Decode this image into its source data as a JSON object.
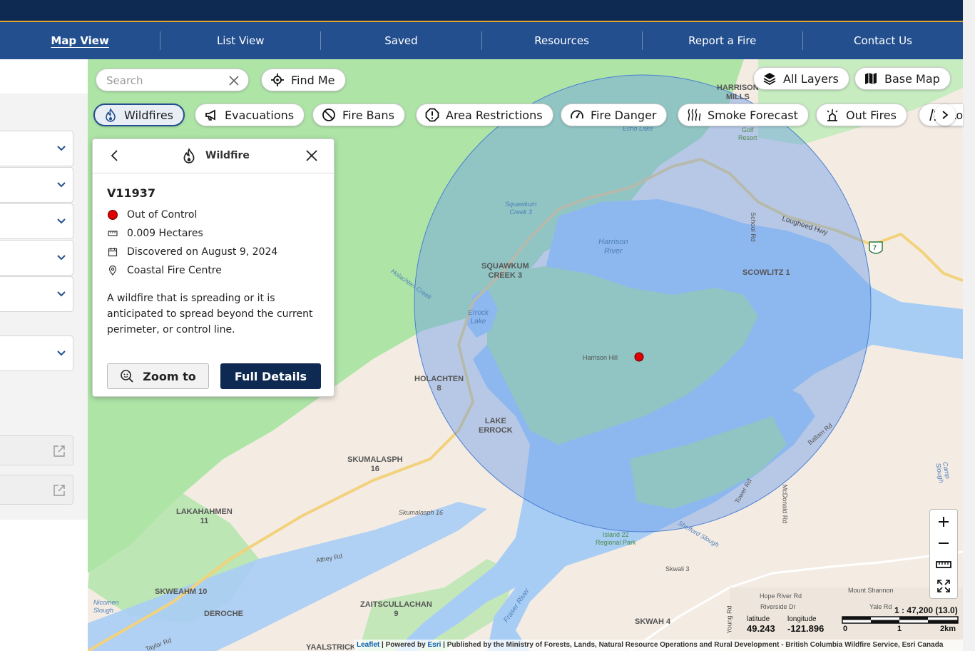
{
  "nav": {
    "items": [
      {
        "label": "Map View",
        "active": true
      },
      {
        "label": "List View",
        "active": false
      },
      {
        "label": "Saved",
        "active": false
      },
      {
        "label": "Resources",
        "active": false
      },
      {
        "label": "Report a Fire",
        "active": false
      },
      {
        "label": "Contact Us",
        "active": false
      }
    ]
  },
  "search": {
    "placeholder": "Search"
  },
  "find_me": {
    "label": "Find Me"
  },
  "layers": {
    "all_layers": "All Layers",
    "base_map": "Base Map"
  },
  "filters": {
    "wildfires": "Wildfires",
    "evacuations": "Evacuations",
    "fire_bans": "Fire Bans",
    "area_restrictions": "Area Restrictions",
    "fire_danger": "Fire Danger",
    "smoke_forecast": "Smoke Forecast",
    "out_fires": "Out Fires",
    "partial_next": "Ro"
  },
  "popup": {
    "header": "Wildfire",
    "fire_id": "V11937",
    "status": "Out of Control",
    "size": "0.009 Hectares",
    "discovered": "Discovered on August 9, 2024",
    "centre": "Coastal Fire Centre",
    "description": "A wildfire that is spreading or it is anticipated to spread beyond the current perimeter, or control line.",
    "zoom_to": "Zoom to",
    "full_details": "Full Details"
  },
  "map_labels": {
    "harrison_mills": [
      "HARRISON",
      "MILLS"
    ],
    "echo_lake": "Echo Lake",
    "golf_resort": [
      "Golf",
      "Resort"
    ],
    "squawkum_creek": [
      "Squawkum",
      "Creek 3"
    ],
    "harrison_river": [
      "Harrison",
      "River"
    ],
    "lougheed_hwy": "Lougheed Hwy",
    "school_rd": "School Rd",
    "squawkum_creek3": [
      "SQUAWKUM",
      "CREEK 3"
    ],
    "scowlitz": "SCOWLITZ 1",
    "holachten_creek": "Holachten Creek",
    "errock_lake": [
      "Errock",
      "Lake"
    ],
    "harrison_hill": "Harrison Hill",
    "holachten8": [
      "HOLACHTEN",
      "8"
    ],
    "lake_errock": [
      "LAKE",
      "ERROCK"
    ],
    "skumalasph16": [
      "SKUMALASPH",
      "16"
    ],
    "skumalasph16b": "Skumalasph 16",
    "lakahahmen": [
      "LAKAHAHMEN",
      "11"
    ],
    "ballam_rd": "Ballam Rd",
    "tower_rd": "Tower Rd",
    "mcdonald_rd": "McDonald Rd",
    "camp_slough": "Camp Slough",
    "shefford_slough": "Shefford Slough",
    "island22": [
      "Island 22",
      "Regional Park"
    ],
    "athey_rd": "Athey Rd",
    "skwali": "Skwali 3",
    "skweahm": "SKWEAHM 10",
    "nicomen": [
      "Nicomen",
      "Slough"
    ],
    "deroche": "DEROCHE",
    "zaitscullachan": [
      "ZAITSCULLACHAN",
      "9"
    ],
    "fraser_river": "Fraser River",
    "hope_river_rd": "Hope River Rd",
    "mount_shannon": "Mount Shannon",
    "riverside_dr": "Riverside Dr",
    "yale_rd": "Yale Rd",
    "skwah": "SKWAH 4",
    "yaalstrick": "YAALSTRICK",
    "taylor_rd": "Taylor Rd",
    "young_rd": "Young Rd",
    "hwy7": "7"
  },
  "coords": {
    "lat_label": "latitude",
    "lat": "49.243",
    "lon_label": "longitude",
    "lon": "-121.896"
  },
  "scale": {
    "ratio": "1 : 47,200 (13.0)",
    "t0": "0",
    "t1": "1",
    "t2": "2km"
  },
  "attribution": {
    "leaflet": "Leaflet",
    "powered": " | Powered by ",
    "esri": "Esri",
    "rest": " | Published by the Ministry of Forests, Lands, Natural Resource Operations and Rural Development - British Columbia Wildfire Service, Esri Canada"
  },
  "colors": {
    "navy": "#0f2a52",
    "nav": "#234f8f",
    "accent": "#e3a82b",
    "water": "#a8cdf5",
    "park": "#aee5a7",
    "status_red": "#e00000"
  }
}
